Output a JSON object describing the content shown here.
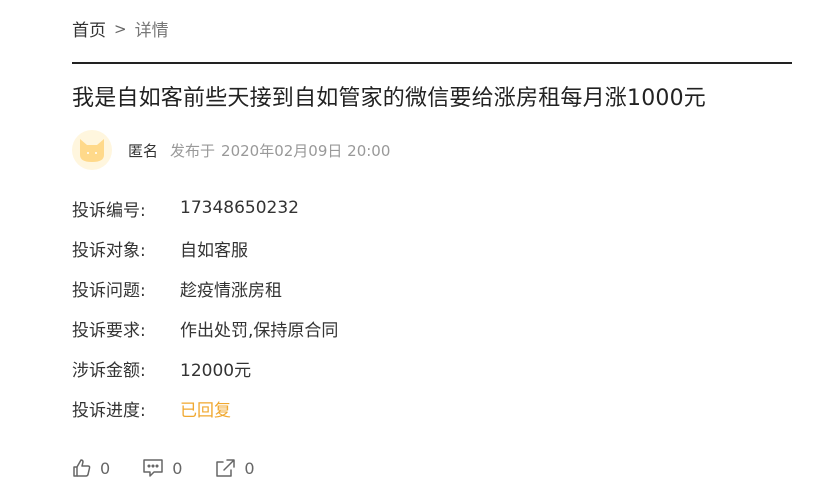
{
  "breadcrumb": {
    "home": "首页",
    "separator": ">",
    "current": "详情"
  },
  "title": "我是自如客前些天接到自如管家的微信要给涨房租每月涨1000元",
  "author": {
    "avatar_icon": "cat-avatar-icon",
    "name": "匿名",
    "publish_prefix": "发布于",
    "publish_time": "2020年02月09日 20:00"
  },
  "fields": [
    {
      "label": "投诉编号:",
      "value": "17348650232"
    },
    {
      "label": "投诉对象:",
      "value": "自如客服"
    },
    {
      "label": "投诉问题:",
      "value": "趁疫情涨房租"
    },
    {
      "label": "投诉要求:",
      "value": "作出处罚,保持原合同"
    },
    {
      "label": "涉诉金额:",
      "value": "12000元"
    },
    {
      "label": "投诉进度:",
      "value": "已回复"
    }
  ],
  "actions": {
    "like_count": "0",
    "comment_count": "0",
    "share_count": "0"
  },
  "colors": {
    "status": "#f0a830",
    "avatar_bg": "#fff6de",
    "avatar_cat": "#ffd98a"
  }
}
